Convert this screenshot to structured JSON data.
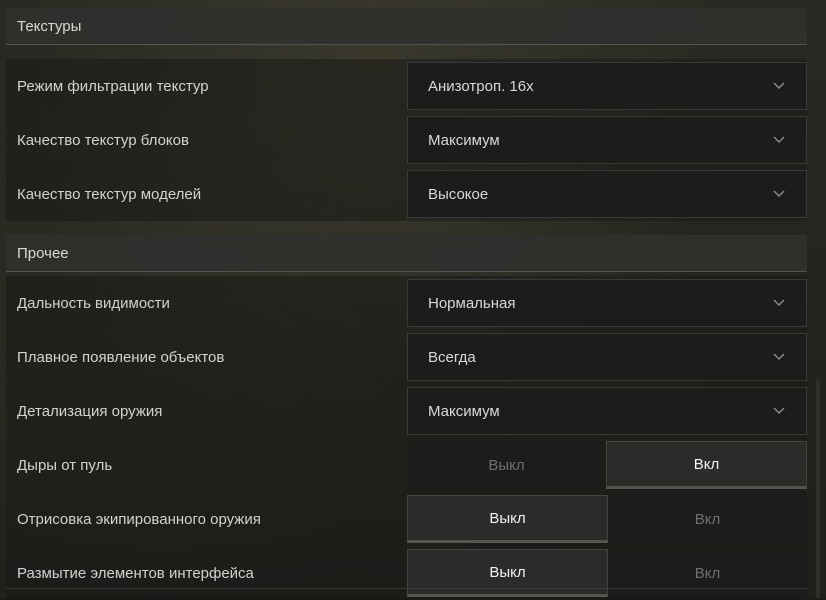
{
  "sections": [
    {
      "title": "Текстуры",
      "rows": [
        {
          "label": "Режим фильтрации текстур",
          "type": "dropdown",
          "value": "Анизотроп. 16x"
        },
        {
          "label": "Качество текстур блоков",
          "type": "dropdown",
          "value": "Максимум"
        },
        {
          "label": "Качество текстур моделей",
          "type": "dropdown",
          "value": "Высокое"
        }
      ]
    },
    {
      "title": "Прочее",
      "rows": [
        {
          "label": "Дальность видимости",
          "type": "dropdown",
          "value": "Нормальная"
        },
        {
          "label": "Плавное появление объектов",
          "type": "dropdown",
          "value": "Всегда"
        },
        {
          "label": "Детализация оружия",
          "type": "dropdown",
          "value": "Максимум"
        },
        {
          "label": "Дыры от пуль",
          "type": "toggle",
          "off": "Выкл",
          "on": "Вкл",
          "selected": "on"
        },
        {
          "label": "Отрисовка экипированного оружия",
          "type": "toggle",
          "off": "Выкл",
          "on": "Вкл",
          "selected": "off"
        },
        {
          "label": "Размытие элементов интерфейса",
          "type": "toggle",
          "off": "Выкл",
          "on": "Вкл",
          "selected": "off"
        }
      ]
    }
  ],
  "icons": {
    "dropdown": "chevron-down-icon"
  },
  "colors": {
    "background": "#1a1a17",
    "selected_toggle": "#2b2b29",
    "text": "#d8d8d4"
  }
}
